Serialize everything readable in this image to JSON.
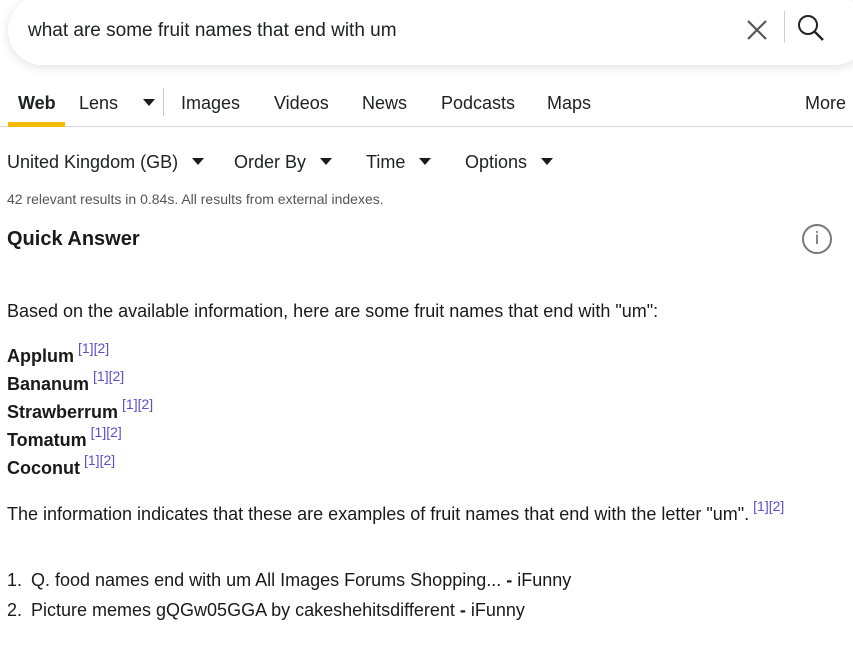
{
  "search": {
    "query": "what are some fruit names that end with um"
  },
  "tabs": [
    {
      "label": "Web"
    },
    {
      "label": "Lens"
    },
    {
      "label": "Images"
    },
    {
      "label": "Videos"
    },
    {
      "label": "News"
    },
    {
      "label": "Podcasts"
    },
    {
      "label": "Maps"
    },
    {
      "label": "More"
    }
  ],
  "filters": [
    {
      "label": "United Kingdom (GB)"
    },
    {
      "label": "Order By"
    },
    {
      "label": "Time"
    },
    {
      "label": "Options"
    }
  ],
  "stats": "42 relevant results in 0.84s. All results from external indexes.",
  "quick_answer": {
    "title": "Quick Answer",
    "info_glyph": "i",
    "intro": "Based on the available information, here are some fruit names that end with \"um\":",
    "items": [
      {
        "name": "Applum",
        "cite1": "[1]",
        "cite2": "[2]"
      },
      {
        "name": "Bananum",
        "cite1": "[1]",
        "cite2": "[2]"
      },
      {
        "name": "Strawberrum",
        "cite1": "[1]",
        "cite2": "[2]"
      },
      {
        "name": "Tomatum",
        "cite1": "[1]",
        "cite2": "[2]"
      },
      {
        "name": "Coconut",
        "cite1": "[1]",
        "cite2": "[2]"
      }
    ],
    "conclusion": "The information indicates that these are examples of fruit names that end with the letter \"um\".",
    "conclusion_cite1": "[1]",
    "conclusion_cite2": "[2]",
    "sources": [
      {
        "num": "1.",
        "title": "Q. food names end with um All Images Forums Shopping...",
        "site": "iFunny"
      },
      {
        "num": "2.",
        "title": "Picture memes gQGw05GGA by cakeshehitsdifferent",
        "site": "iFunny"
      }
    ],
    "source_separator": " - "
  },
  "colors": {
    "accent": "#f5bb00",
    "citation": "#5a4fcf"
  }
}
